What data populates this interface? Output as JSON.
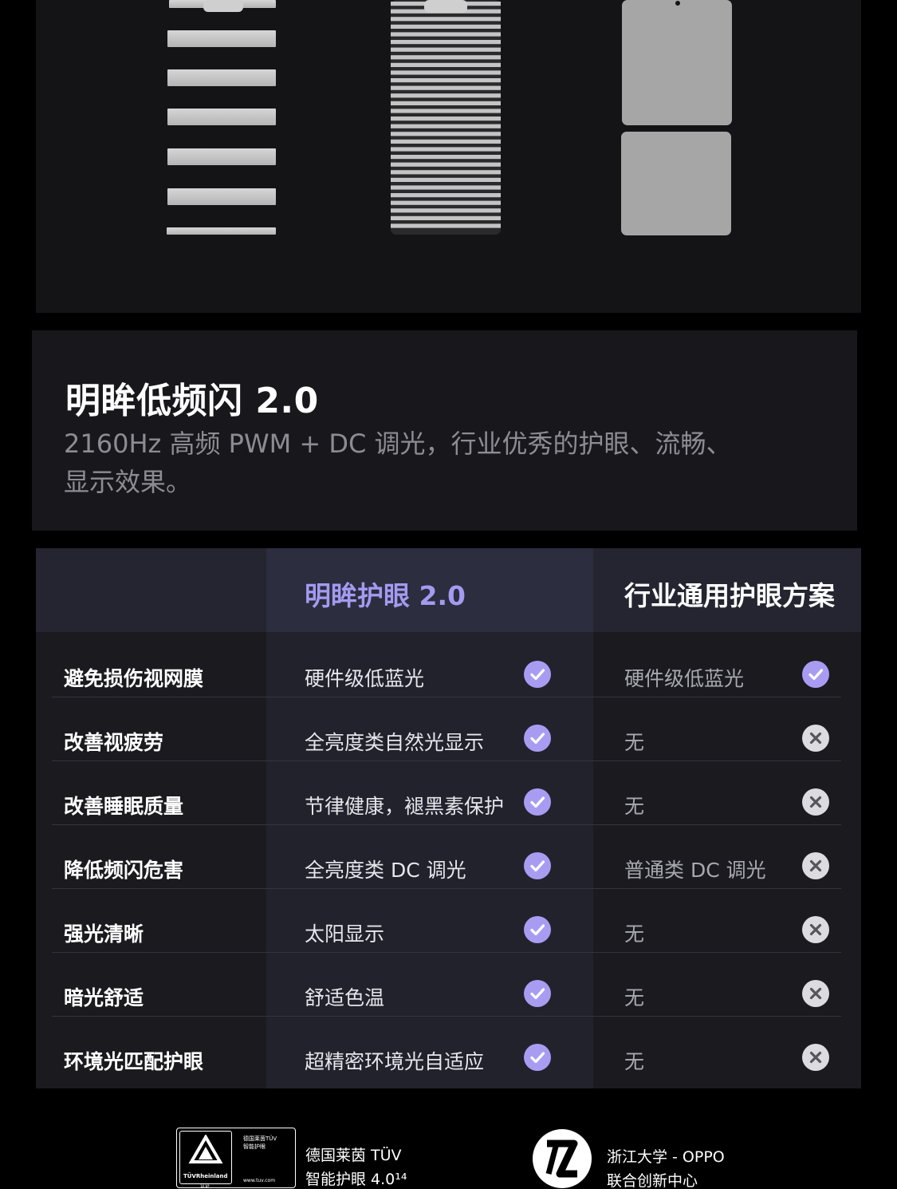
{
  "feature": {
    "title": "明眸低频闪 2.0",
    "description_line1": "2160Hz 高频 PWM + DC 调光，行业优秀的护眼、流畅、",
    "description_line2": "显示效果。"
  },
  "table": {
    "header_ours": "明眸护眼 2.0",
    "header_industry": "行业通用护眼方案",
    "rows": [
      {
        "label": "避免损伤视网膜",
        "ours": "硬件级低蓝光",
        "ours_status": "check",
        "industry": "硬件级低蓝光",
        "industry_status": "check"
      },
      {
        "label": "改善视疲劳",
        "ours": "全亮度类自然光显示",
        "ours_status": "check",
        "industry": "无",
        "industry_status": "cross"
      },
      {
        "label": "改善睡眠质量",
        "ours": "节律健康，褪黑素保护",
        "ours_status": "check",
        "industry": "无",
        "industry_status": "cross"
      },
      {
        "label": "降低频闪危害",
        "ours": "全亮度类 DC 调光",
        "ours_status": "check",
        "industry": "普通类 DC 调光",
        "industry_status": "cross"
      },
      {
        "label": "强光清晰",
        "ours": "太阳显示",
        "ours_status": "check",
        "industry": "无",
        "industry_status": "cross"
      },
      {
        "label": "暗光舒适",
        "ours": "舒适色温",
        "ours_status": "check",
        "industry": "无",
        "industry_status": "cross"
      },
      {
        "label": "环境光匹配护眼",
        "ours": "超精密环境光自适应",
        "ours_status": "check",
        "industry": "无",
        "industry_status": "cross"
      }
    ]
  },
  "footer": {
    "tuv_badge": {
      "brand": "TÜVRheinland",
      "badge_title": "德国莱茵TÜV",
      "badge_subtitle": "智能护眼",
      "badge_cert": "认证",
      "badge_url": "www.tuv.com"
    },
    "tuv_line1": "德国莱茵 TÜV",
    "tuv_line2": "智能护眼 4.0¹⁴",
    "zju_line1": "浙江大学 - OPPO",
    "zju_line2": "联合创新中心"
  },
  "icons": {
    "check": "check-circle-icon",
    "cross": "cross-circle-icon"
  },
  "colors": {
    "accent": "#a89cf2",
    "header_ours_text": "#a49af0",
    "cross_icon": "#dcdce0"
  }
}
